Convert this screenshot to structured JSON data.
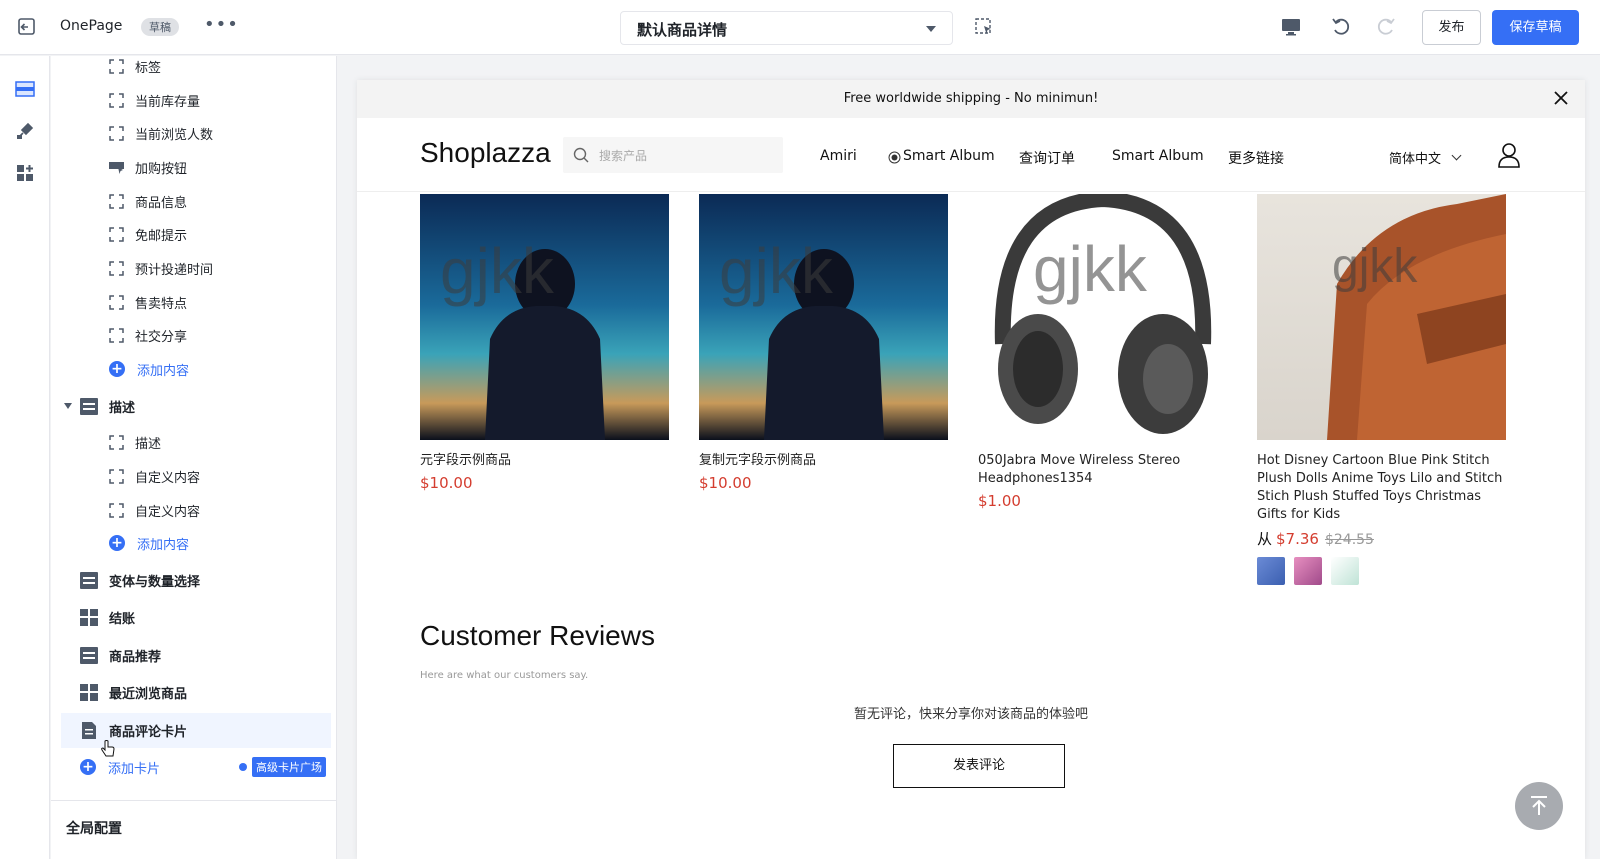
{
  "topbar": {
    "app_name": "OnePage",
    "draft_badge": "草稿",
    "more": "•••",
    "template": "默认商品详情",
    "publish_label": "发布",
    "save_label": "保存草稿"
  },
  "sidebar": {
    "sub_items_top": [
      "标签",
      "当前库存量",
      "当前浏览人数",
      "加购按钮",
      "商品信息",
      "免邮提示",
      "预计投递时间",
      "售卖特点",
      "社交分享"
    ],
    "add_content": "添加内容",
    "description_section": "描述",
    "description_items": [
      "描述",
      "自定义内容",
      "自定义内容"
    ],
    "sections": [
      "变体与数量选择",
      "结账",
      "商品推荐",
      "最近浏览商品",
      "商品评论卡片"
    ],
    "add_card": "添加卡片",
    "advanced_card_square": "高级卡片广场",
    "global_config": "全局配置"
  },
  "preview": {
    "announcement": "Free worldwide shipping - No minimun!",
    "logo": "Shoplazza",
    "search_placeholder": "搜索产品",
    "nav": [
      "Amiri",
      "Smart Album",
      "查询订单",
      "Smart Album",
      "更多链接"
    ],
    "language": "简体中文",
    "watermark": "gjkk",
    "products": [
      {
        "name": "元字段示例商品",
        "price": "$10.00"
      },
      {
        "name": "复制元字段示例商品",
        "price": "$10.00"
      },
      {
        "name": "050Jabra Move Wireless Stereo Headphones1354",
        "price": "$1.00"
      },
      {
        "name": "Hot Disney Cartoon Blue Pink Stitch Plush Dolls Anime Toys Lilo and Stitch Stich Plush Stuffed Toys Christmas Gifts for Kids",
        "price_prefix": "从",
        "price": "$7.36",
        "compare_price": "$24.55"
      }
    ],
    "reviews_title": "Customer Reviews",
    "reviews_subtitle": "Here are what our customers say.",
    "reviews_empty": "暂无评论，快来分享你对该商品的体验吧",
    "write_review": "发表评论"
  },
  "colors": {
    "accent": "#356ff5",
    "price": "#d43d2f"
  }
}
